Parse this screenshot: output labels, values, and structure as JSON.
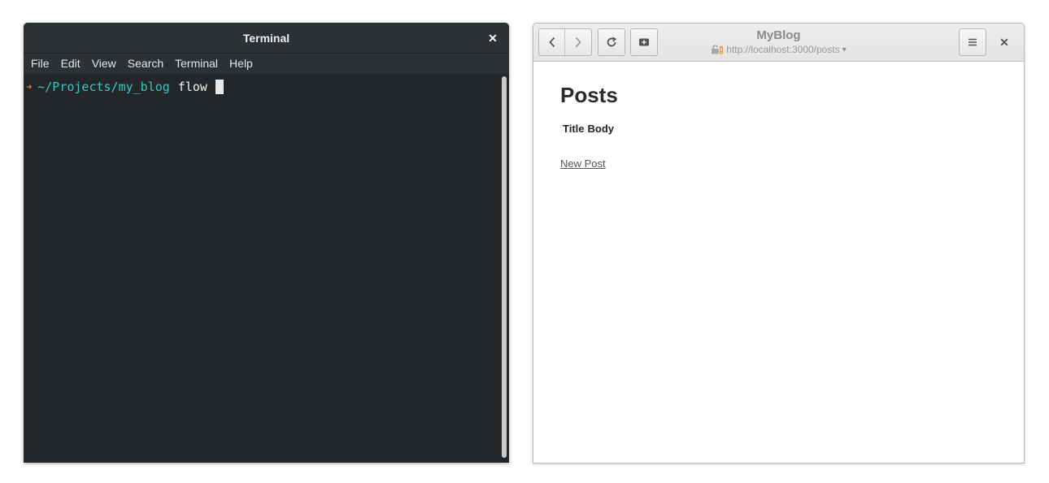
{
  "terminal": {
    "title": "Terminal",
    "close_glyph": "✕",
    "menu": [
      "File",
      "Edit",
      "View",
      "Search",
      "Terminal",
      "Help"
    ],
    "prompt_arrow": "➜",
    "prompt_path": "~/Projects/my_blog",
    "command": "flow",
    "colors": {
      "background": "#232729",
      "path": "#35c7c4",
      "arrow": "#e0813f"
    }
  },
  "browser": {
    "title": "MyBlog",
    "url": "http://localhost:3000/posts",
    "url_caret": "▾",
    "close_glyph": "✕",
    "page": {
      "heading": "Posts",
      "columns": [
        "Title",
        "Body"
      ],
      "new_post_link": "New Post"
    }
  }
}
